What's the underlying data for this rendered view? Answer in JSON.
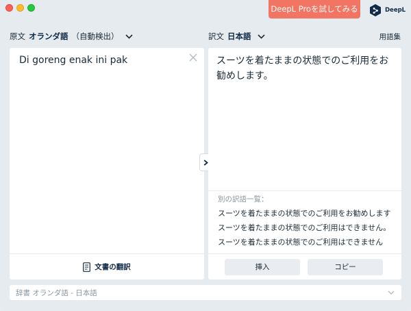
{
  "titlebar": {
    "pro_button": "DeepL Proを試してみる",
    "brand_name": "DeepL"
  },
  "source": {
    "prefix": "原文",
    "language": "オランダ語",
    "detect": "（自動検出）",
    "text": "Di goreng enak ini pak",
    "document_label": "文書の翻訳"
  },
  "target": {
    "prefix": "訳文",
    "language": "日本語",
    "glossary": "用語集",
    "text": "スーツを着たままの状態でのご利用をお勧めします。",
    "alternatives_title": "別の訳語一覧：",
    "alternatives": [
      "スーツを着たままの状態でのご利用をお勧めします",
      "スーツを着たままの状態でのご利用はできません。",
      "スーツを着たままの状態でのご利用はできません"
    ],
    "insert_button": "挿入",
    "copy_button": "コピー"
  },
  "dictionary": {
    "label": "辞書 オランダ語 - 日本語"
  },
  "colors": {
    "accent": "#f27462",
    "brand": "#0f2b46",
    "background": "#e6ebef"
  },
  "icons": {
    "clear": "close-icon",
    "swap": "chevron-right-icon",
    "document": "document-icon",
    "dropdown": "chevron-down-icon"
  }
}
